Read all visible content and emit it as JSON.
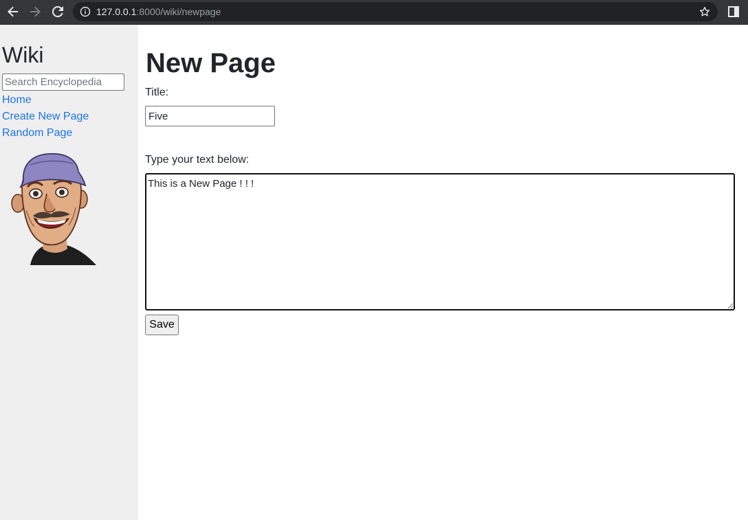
{
  "browser": {
    "url_host": "127.0.0.1",
    "url_rest": ":8000/wiki/newpage"
  },
  "sidebar": {
    "heading": "Wiki",
    "search_placeholder": "Search Encyclopedia",
    "links": [
      {
        "label": "Home"
      },
      {
        "label": "Create New Page"
      },
      {
        "label": "Random Page"
      }
    ]
  },
  "main": {
    "heading": "New Page",
    "title_label": "Title:",
    "title_value": "Five",
    "content_label": "Type your text below:",
    "content_value": "This is a New Page ! ! !",
    "save_label": "Save"
  },
  "colors": {
    "link": "#1a73e8",
    "sidebar_bg": "#efefef",
    "chrome_bg": "#35363a"
  }
}
